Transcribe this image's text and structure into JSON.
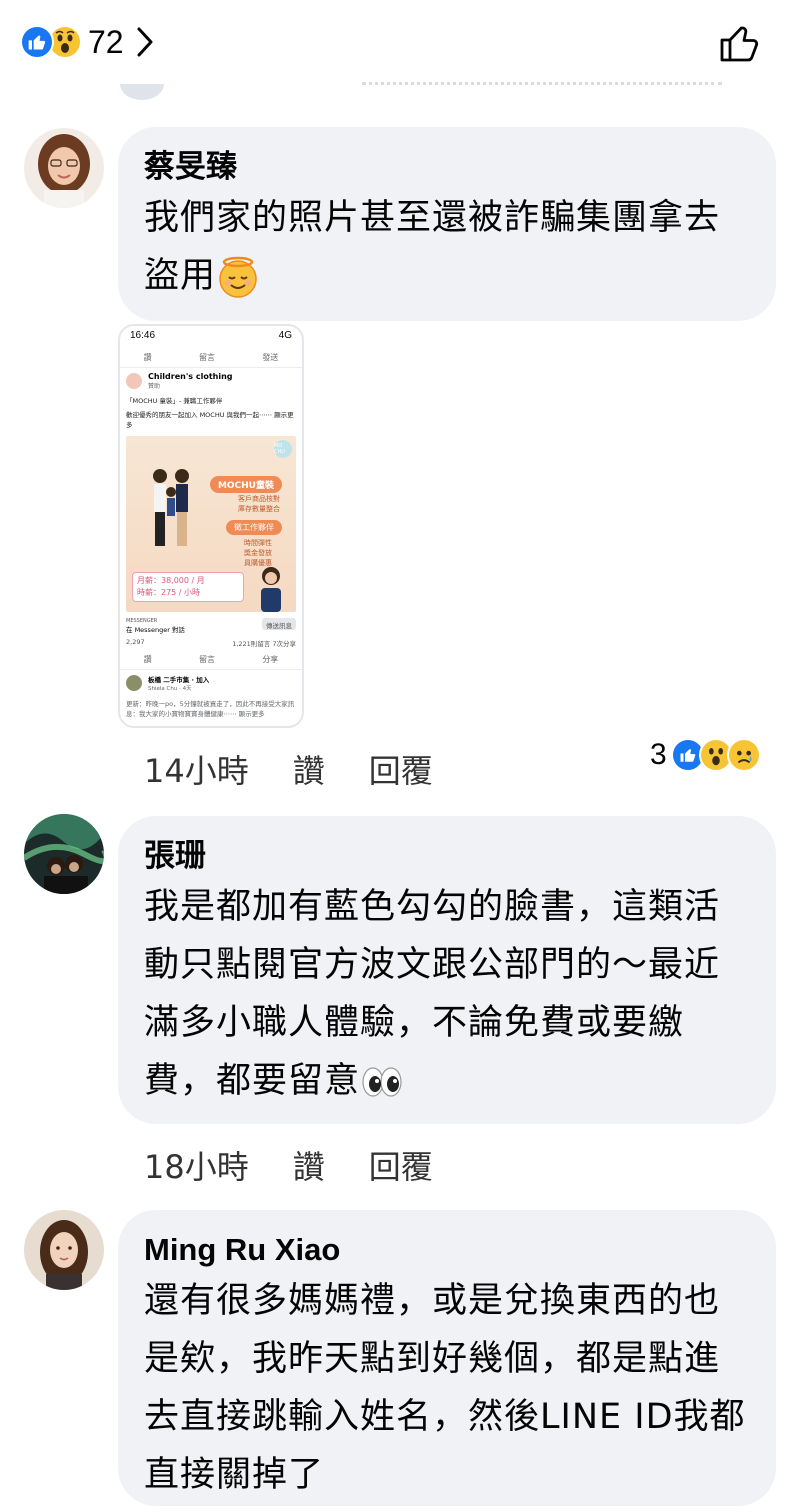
{
  "header": {
    "reaction_count": "72",
    "reaction_icons": [
      "like-reaction",
      "wow-reaction"
    ]
  },
  "comments": [
    {
      "author": "蔡旻臻",
      "lines": [
        "我們家的照片甚至還被詐騙集團拿去",
        "盜用"
      ],
      "emoji": "smiling-face-with-halo",
      "time": "14小時",
      "like_label": "讚",
      "reply_label": "回覆",
      "reaction_count": "3",
      "reaction_icons": [
        "like-reaction",
        "wow-reaction",
        "sad-reaction"
      ],
      "attachment": {
        "status_time": "16:46",
        "status_signal": "4G",
        "nav": [
          "讚",
          "留言",
          "發送"
        ],
        "page_name": "Children's clothing",
        "page_sub": "贊助",
        "post_title": "「MOCHU 童裝」- 兼職工作夥伴",
        "post_body": "歡迎優秀的朋友一起加入 MOCHU 與我們一起⋯⋯ 顯示更多",
        "ad_brand": "MOCHU童裝",
        "ad_lines_1": [
          "客戶商品核對",
          "庫存數量整合"
        ],
        "ad_tag": "徵工作夥伴",
        "ad_lines_2": [
          "時間彈性",
          "獎金發放",
          "員購優惠"
        ],
        "ad_salary_1": "月薪：38,000 / 月",
        "ad_salary_2": "時薪：275 / 小時",
        "ad_logo": "MO CHU",
        "messenger_label": "MESSENGER",
        "messenger_cta": "在 Messenger 對話",
        "messenger_button": "傳送訊息",
        "stats_likes": "2,297",
        "stats_right": "1,221則留言 7次分享",
        "nav2": [
          "讚",
          "留言",
          "分享"
        ],
        "next_page": "板橋 二手市集 · 加入",
        "next_sub": "Shiela Chu · 4天",
        "next_body": "更新：昨晚一po，5分鐘就被買走了，因此不再接受大家訊息：我大家的小寶物寶寶身體健康⋯⋯ 顯示更多"
      }
    },
    {
      "author": "張珊",
      "lines": [
        "我是都加有藍色勾勾的臉書，這類活",
        "動只點閱官方波文跟公部門的～最近",
        "滿多小職人體驗，不論免費或要繳",
        "費，都要留意"
      ],
      "emoji": "eyes",
      "time": "18小時",
      "like_label": "讚",
      "reply_label": "回覆"
    },
    {
      "author": "Ming Ru Xiao",
      "lines": [
        "還有很多媽媽禮，或是兌換東西的也",
        "是欸，我昨天點到好幾個，都是點進",
        "去直接跳輸入姓名，然後LINE ID我都",
        "直接關掉了"
      ]
    }
  ]
}
